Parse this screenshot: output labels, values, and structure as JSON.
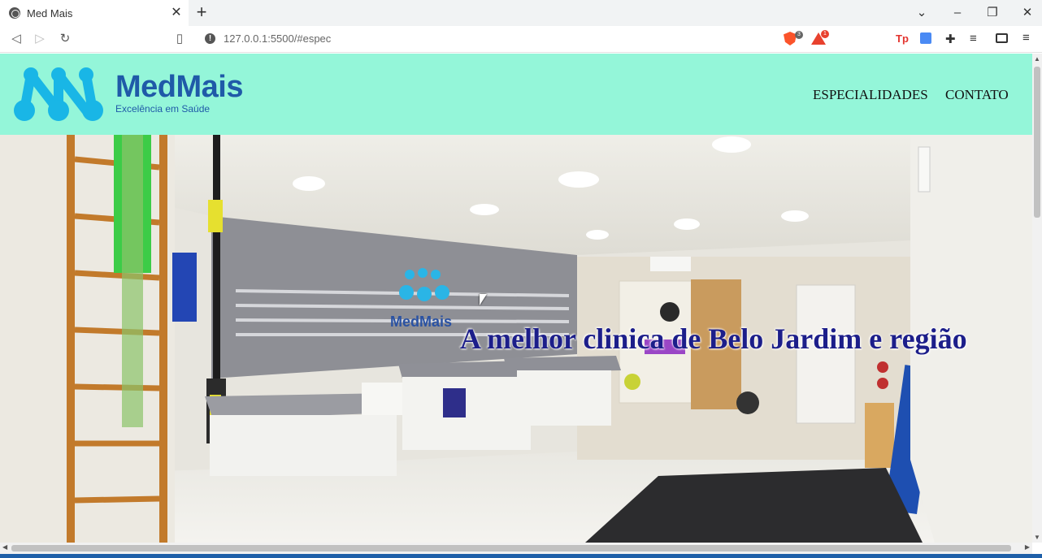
{
  "browser": {
    "tab_title": "Med Mais",
    "tab_close_glyph": "✕",
    "new_tab_glyph": "+",
    "url": "127.0.0.1:5500/#espec",
    "tab_list_glyph": "⌄",
    "minimize_glyph": "–",
    "restore_glyph": "❐",
    "close_glyph": "✕",
    "back_glyph": "◁",
    "forward_glyph": "▷",
    "reload_glyph": "↻",
    "bookmark_glyph": "▯",
    "info_glyph": "!",
    "brave_shields_count": "3",
    "rewards_count": "1",
    "ext_tp_label": "Tp",
    "puzzle_glyph": "✚",
    "playlist_glyph": "≡",
    "menu_glyph": "≡"
  },
  "site": {
    "brand_name": "MedMais",
    "tagline": "Excelência em Saúde",
    "nav": [
      {
        "label": "ESPECIALIDADES"
      },
      {
        "label": "CONTATO"
      }
    ],
    "hero_headline": "A melhor clinica de Belo Jardim e região",
    "colors": {
      "header_bg": "#94f6d9",
      "brand_blue": "#1f5aa8",
      "logo_cyan": "#19b6e6",
      "headline": "#1c1e8a"
    }
  }
}
